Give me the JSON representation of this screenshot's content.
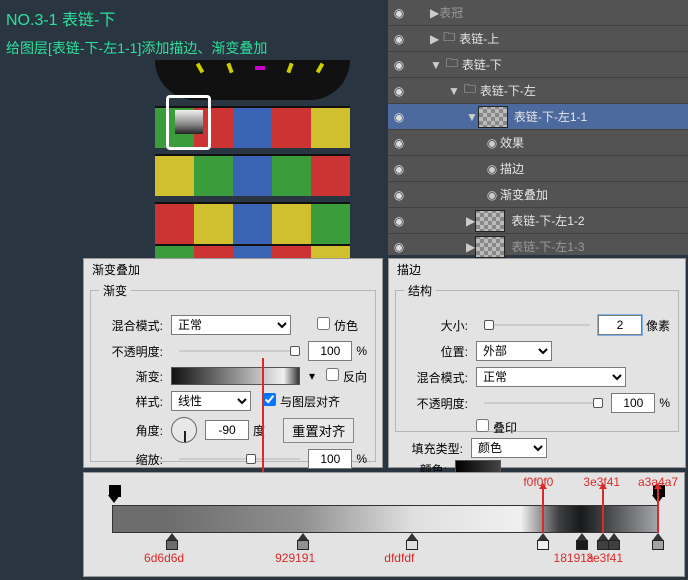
{
  "header": {
    "title": "NO.3-1 表链-下",
    "subtitle": "给图层[表链-下-左1-1]添加描边、渐变叠加"
  },
  "layers_panel": {
    "rows": [
      {
        "indent": 0,
        "fold": "r",
        "name": "表冠",
        "dim": true
      },
      {
        "indent": 0,
        "fold": "r",
        "icon": "folder",
        "name": "表链-上"
      },
      {
        "indent": 0,
        "fold": "d",
        "icon": "folder",
        "name": "表链-下"
      },
      {
        "indent": 1,
        "fold": "d",
        "icon": "folder",
        "name": "表链-下-左"
      },
      {
        "indent": 2,
        "thumb": true,
        "name": "表链-下-左1-1",
        "selected": true,
        "fold": "d"
      },
      {
        "indent": 3,
        "fx": true,
        "name": "效果"
      },
      {
        "indent": 3,
        "fx": true,
        "name": "描边"
      },
      {
        "indent": 3,
        "fx": true,
        "name": "渐变叠加"
      },
      {
        "indent": 2,
        "thumb": true,
        "name": "表链-下-左1-2"
      },
      {
        "indent": 2,
        "thumb": true,
        "name": "表链-下-左1-3",
        "dim": true
      }
    ]
  },
  "gradient_overlay": {
    "panel_title": "渐变叠加",
    "legend": "渐变",
    "blend_label": "混合模式:",
    "blend_value": "正常",
    "dither_label": "仿色",
    "opacity_label": "不透明度:",
    "opacity_value": "100",
    "opacity_unit": "%",
    "grad_label": "渐变:",
    "reverse_label": "反向",
    "style_label": "样式:",
    "style_value": "线性",
    "align_label": "与图层对齐",
    "angle_label": "角度:",
    "angle_value": "-90",
    "angle_unit": "度",
    "reset_label": "重置对齐",
    "scale_label": "缩放:",
    "scale_value": "100",
    "scale_unit": "%"
  },
  "stroke": {
    "panel_title": "描边",
    "legend": "结构",
    "size_label": "大小:",
    "size_value": "2",
    "size_unit": "像素",
    "pos_label": "位置:",
    "pos_value": "外部",
    "blend_label": "混合模式:",
    "blend_value": "正常",
    "opacity_label": "不透明度:",
    "opacity_value": "100",
    "opacity_unit": "%",
    "overprint_label": "叠印",
    "fill_label": "填充类型:",
    "fill_value": "颜色",
    "color_label": "颜色:"
  },
  "grad_editor": {
    "stops": [
      {
        "hex": "6d6d6d",
        "pos": 11
      },
      {
        "hex": "929191",
        "pos": 35
      },
      {
        "hex": "dfdfdf",
        "pos": 55
      },
      {
        "hex": "f0f0f0",
        "pos": 79,
        "top": true
      },
      {
        "hex": "18191a",
        "pos": 86
      },
      {
        "hex": "3e3f41",
        "pos": 90,
        "top": true
      },
      {
        "hex": "3e3f41",
        "pos": 92
      },
      {
        "hex": "a3a4a7",
        "pos": 100,
        "top": true
      }
    ]
  }
}
